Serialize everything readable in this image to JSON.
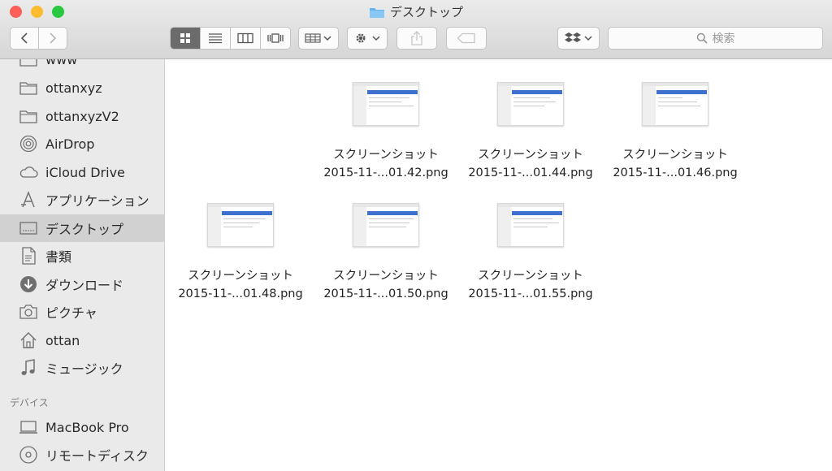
{
  "window": {
    "title": "デスクトップ"
  },
  "toolbar": {
    "view_modes": [
      "icon-view",
      "list-view",
      "column-view",
      "coverflow-view"
    ],
    "search_placeholder": "検索"
  },
  "sidebar": {
    "items": [
      {
        "label": "www",
        "icon": "folder-icon"
      },
      {
        "label": "ottanxyz",
        "icon": "folder-icon"
      },
      {
        "label": "ottanxyzV2",
        "icon": "folder-icon"
      },
      {
        "label": "AirDrop",
        "icon": "airdrop-icon"
      },
      {
        "label": "iCloud Drive",
        "icon": "cloud-icon"
      },
      {
        "label": "アプリケーション",
        "icon": "applications-icon"
      },
      {
        "label": "デスクトップ",
        "icon": "desktop-icon",
        "selected": true
      },
      {
        "label": "書類",
        "icon": "documents-icon"
      },
      {
        "label": "ダウンロード",
        "icon": "download-icon"
      },
      {
        "label": "ピクチャ",
        "icon": "camera-icon"
      },
      {
        "label": "ottan",
        "icon": "home-icon"
      },
      {
        "label": "ミュージック",
        "icon": "music-icon"
      }
    ],
    "section_devices": "デバイス",
    "devices": [
      {
        "label": "MacBook Pro",
        "icon": "laptop-icon"
      },
      {
        "label": "リモートディスク",
        "icon": "disc-icon"
      }
    ]
  },
  "files": [
    {
      "line1": "スクリーンショット",
      "line2": "2015-11-...01.42.png"
    },
    {
      "line1": "スクリーンショット",
      "line2": "2015-11-...01.44.png"
    },
    {
      "line1": "スクリーンショット",
      "line2": "2015-11-...01.46.png"
    },
    {
      "line1": "スクリーンショット",
      "line2": "2015-11-...01.48.png"
    },
    {
      "line1": "スクリーンショット",
      "line2": "2015-11-...01.50.png"
    },
    {
      "line1": "スクリーンショット",
      "line2": "2015-11-...01.55.png"
    }
  ]
}
